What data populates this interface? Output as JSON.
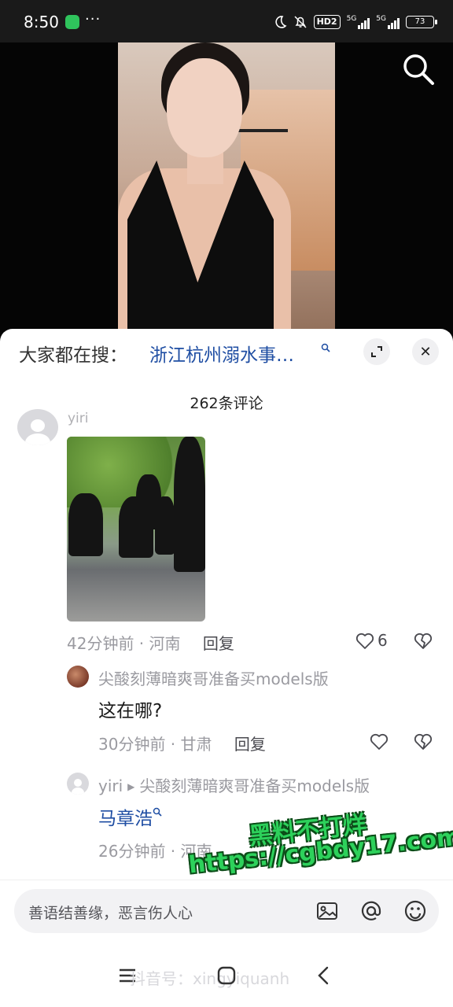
{
  "status_bar": {
    "time": "8:50",
    "dots": "···",
    "hd_label": "HD2",
    "sim1_label": "5G",
    "sim2_label": "5G",
    "battery": "73"
  },
  "video": {
    "search_icon": "search-icon"
  },
  "sheet": {
    "hot_search_prefix": "大家都在搜：",
    "hot_search_term": "浙江杭州溺水事…",
    "expand_icon": "expand-icon",
    "close_icon": "close-icon",
    "close_glyph": "✕",
    "comment_count": "262条评论"
  },
  "comments": {
    "main": {
      "username": "yiri",
      "time": "42分钟前",
      "separator": " · ",
      "location": "河南",
      "reply_label": "回复",
      "likes": "6"
    },
    "sub": {
      "username": "尖酸刻薄暗爽哥准备买models版",
      "text": "这在哪?",
      "time": "30分钟前",
      "separator": " · ",
      "location": "甘肃",
      "reply_label": "回复"
    },
    "reply": {
      "username": "yiri",
      "arrow": "▶",
      "target_user": "尖酸刻薄暗爽哥准备买models版",
      "text": "马章浩",
      "time": "26分钟前",
      "separator": " · ",
      "location": "河南"
    }
  },
  "input": {
    "placeholder": "善语结善缘，恶言伤人心",
    "image_icon": "image-icon",
    "at_icon": "at-icon",
    "emoji_icon": "emoji-icon"
  },
  "nav": {
    "watermark": "抖音号：xingyiquanh"
  },
  "watermark": {
    "line1": "黑料不打烊",
    "line2": "https://cgbdy17.com"
  },
  "colors": {
    "link_blue": "#1f4ea3",
    "meta_gray": "#9a9aa0",
    "watermark_green": "#2dd15b"
  }
}
